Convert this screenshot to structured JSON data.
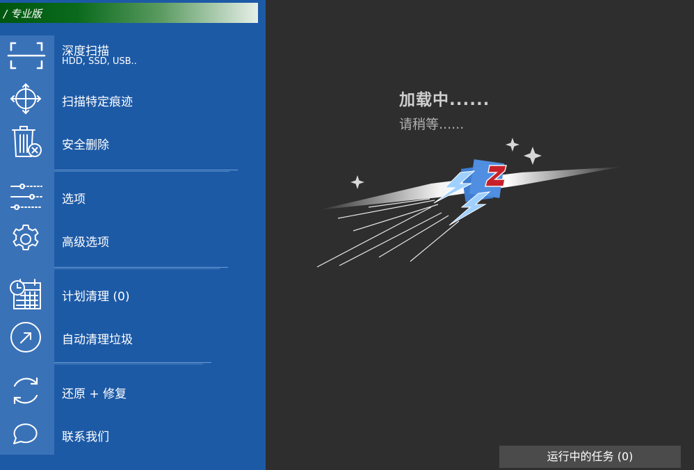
{
  "app": {
    "title": "/ 专业版"
  },
  "menu": {
    "deep_scan": {
      "label": "深度扫描",
      "sublabel": "HDD, SSD, USB.."
    },
    "scan_traces": {
      "label": "扫描特定痕迹"
    },
    "secure_delete": {
      "label": "安全删除"
    },
    "options": {
      "label": "选项"
    },
    "advanced_options": {
      "label": "高级选项"
    },
    "scheduled_clean": {
      "label": "计划清理 (0)"
    },
    "auto_clean": {
      "label": "自动清理垃圾"
    },
    "restore_repair": {
      "label": "还原 + 修复"
    },
    "contact_us": {
      "label": "联系我们"
    }
  },
  "loading": {
    "title": "加载中......",
    "subtitle": "请稍等......"
  },
  "tasks": {
    "label": "运行中的任务 (0)"
  },
  "icons": [
    "scan-frame-icon",
    "crosshair-icon",
    "trash-delete-icon",
    "sliders-icon",
    "gear-icon",
    "calendar-clock-icon",
    "auto-arrow-icon",
    "refresh-icon",
    "chat-bubble-icon"
  ],
  "colors": {
    "sidebar": "#1d5aa6",
    "icon_strip": "#3a72b8",
    "content_bg": "#2e2e2e",
    "title_green": "#00560f",
    "logo_red": "#c8202a"
  }
}
